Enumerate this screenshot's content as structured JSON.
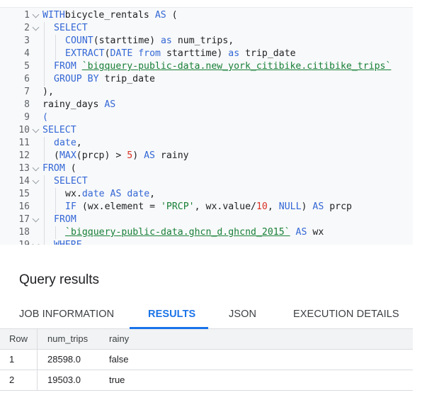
{
  "editor": {
    "lines": [
      {
        "n": "1",
        "fold": true,
        "parts": [
          [
            "kw",
            "WITH"
          ],
          [
            "",
            "bicycle_rentals "
          ],
          [
            "kw",
            "AS"
          ],
          [
            "",
            " ("
          ]
        ],
        "indent": 0
      },
      {
        "n": "2",
        "fold": true,
        "parts": [
          [
            "kw",
            "SELECT"
          ]
        ],
        "indent": 1
      },
      {
        "n": "3",
        "fold": false,
        "parts": [
          [
            "fn",
            "COUNT"
          ],
          [
            "",
            "(starttime) "
          ],
          [
            "kw",
            "as"
          ],
          [
            "",
            " num_trips,"
          ]
        ],
        "indent": 2
      },
      {
        "n": "4",
        "fold": false,
        "parts": [
          [
            "fn",
            "EXTRACT"
          ],
          [
            "",
            "("
          ],
          [
            "kw",
            "DATE"
          ],
          [
            "",
            ""
          ],
          [
            "kw",
            " from"
          ],
          [
            "",
            " starttime) "
          ],
          [
            "kw",
            "as"
          ],
          [
            "",
            " trip_date"
          ]
        ],
        "indent": 2
      },
      {
        "n": "5",
        "fold": false,
        "parts": [
          [
            "kw",
            "FROM"
          ],
          [
            "",
            " "
          ],
          [
            "tbl",
            "`bigquery-public-data.new_york_citibike.citibike_trips`"
          ]
        ],
        "indent": 1
      },
      {
        "n": "6",
        "fold": false,
        "parts": [
          [
            "kw",
            "GROUP BY"
          ],
          [
            "",
            " trip_date"
          ]
        ],
        "indent": 1
      },
      {
        "n": "7",
        "fold": false,
        "parts": [
          [
            "",
            "),"
          ]
        ],
        "indent": 0
      },
      {
        "n": "8",
        "fold": false,
        "parts": [
          [
            "",
            "rainy_days "
          ],
          [
            "kw",
            "AS"
          ]
        ],
        "indent": 0
      },
      {
        "n": "9",
        "fold": false,
        "parts": [
          [
            "kw",
            "("
          ]
        ],
        "indent": 0
      },
      {
        "n": "10",
        "fold": true,
        "parts": [
          [
            "kw",
            "SELECT"
          ]
        ],
        "indent": 0
      },
      {
        "n": "11",
        "fold": false,
        "parts": [
          [
            "kw",
            "date"
          ],
          [
            "",
            ","
          ]
        ],
        "indent": 1
      },
      {
        "n": "12",
        "fold": false,
        "parts": [
          [
            "",
            "("
          ],
          [
            "fn",
            "MAX"
          ],
          [
            "",
            "(prcp) > "
          ],
          [
            "num",
            "5"
          ],
          [
            "",
            ") "
          ],
          [
            "kw",
            "AS"
          ],
          [
            "",
            " rainy"
          ]
        ],
        "indent": 1
      },
      {
        "n": "13",
        "fold": true,
        "parts": [
          [
            "kw",
            "FROM"
          ],
          [
            "",
            " ("
          ]
        ],
        "indent": 0
      },
      {
        "n": "14",
        "fold": true,
        "parts": [
          [
            "kw",
            "SELECT"
          ]
        ],
        "indent": 1
      },
      {
        "n": "15",
        "fold": false,
        "parts": [
          [
            "",
            "wx."
          ],
          [
            "kw",
            "date"
          ],
          [
            "",
            " "
          ],
          [
            "kw",
            "AS"
          ],
          [
            "",
            " "
          ],
          [
            "kw",
            "date"
          ],
          [
            "",
            ","
          ]
        ],
        "indent": 2
      },
      {
        "n": "16",
        "fold": false,
        "parts": [
          [
            "fn",
            "IF"
          ],
          [
            "",
            " (wx.element = "
          ],
          [
            "str",
            "'PRCP'"
          ],
          [
            "",
            ", wx.value/"
          ],
          [
            "num",
            "10"
          ],
          [
            "",
            ", "
          ],
          [
            "kw",
            "NULL"
          ],
          [
            "",
            ") "
          ],
          [
            "kw",
            "AS"
          ],
          [
            "",
            " prcp"
          ]
        ],
        "indent": 2
      },
      {
        "n": "17",
        "fold": true,
        "parts": [
          [
            "kw",
            "FROM"
          ]
        ],
        "indent": 1
      },
      {
        "n": "18",
        "fold": false,
        "parts": [
          [
            "tbl",
            "`bigquery-public-data.ghcn_d.ghcnd_2015`"
          ],
          [
            "",
            " "
          ],
          [
            "kw",
            "AS"
          ],
          [
            "",
            " wx"
          ]
        ],
        "indent": 2
      },
      {
        "n": "19",
        "fold": true,
        "parts": [
          [
            "kw",
            "WHERE"
          ]
        ],
        "indent": 1
      }
    ]
  },
  "results": {
    "title": "Query results",
    "tabs": [
      {
        "label": "JOB INFORMATION",
        "active": false
      },
      {
        "label": "RESULTS",
        "active": true
      },
      {
        "label": "JSON",
        "active": false
      },
      {
        "label": "EXECUTION DETAILS",
        "active": false
      }
    ],
    "headers": [
      "Row",
      "num_trips",
      "rainy"
    ],
    "rows": [
      [
        "1",
        "28598.0",
        "false"
      ],
      [
        "2",
        "19503.0",
        "true"
      ]
    ]
  },
  "colors": {
    "accent": "#1a73e8",
    "keyword": "#3367d6",
    "string": "#188038",
    "number": "#d93025"
  }
}
